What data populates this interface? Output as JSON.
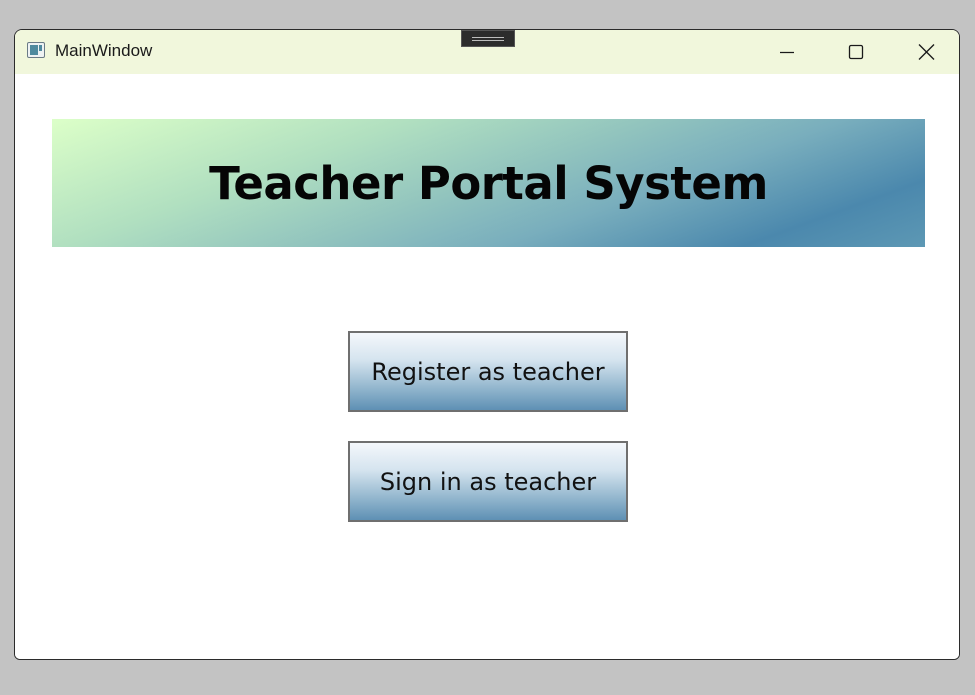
{
  "window": {
    "title": "MainWindow",
    "icons": {
      "app": "app-window-icon",
      "minimize": "minimize-icon",
      "maximize": "maximize-icon",
      "close": "close-icon"
    }
  },
  "main": {
    "heading": "Teacher Portal System",
    "buttons": {
      "register_label": "Register as teacher",
      "signin_label": "Sign in as teacher"
    }
  },
  "colors": {
    "titlebar": "#f1f7dc",
    "banner_start": "#dcffc8",
    "banner_end": "#4b88ad",
    "button_top": "#f4f7fb",
    "button_bottom": "#5e90b4"
  }
}
